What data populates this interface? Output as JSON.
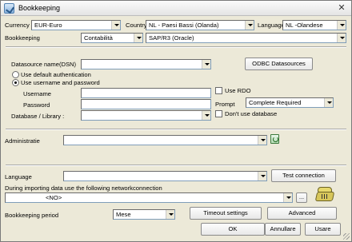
{
  "window": {
    "title": "Bookkeeping",
    "close_glyph": "✕"
  },
  "top": {
    "currency_label": "Currency",
    "currency_value": "EUR-Euro",
    "country_label": "Country",
    "country_value": "NL - Paesi Bassi (Olanda)",
    "language_label": "Language",
    "language_value": "NL -Olandese",
    "bookkeeping_label": "Bookkeeping",
    "bookkeeping_type": "Contabilità",
    "bookkeeping_system": "SAP/R3 (Oracle)"
  },
  "connection": {
    "dsn_label": "Datasource name(DSN)",
    "dsn_value": "",
    "odbc_button": "ODBC Datasources",
    "auth_default": "Use default authentication",
    "auth_userpass": "Use username and password",
    "username_label": "Username",
    "username_value": "",
    "password_label": "Password",
    "password_value": "",
    "use_rdo": "Use RDO",
    "prompt_label": "Prompt",
    "prompt_value": "Complete Required",
    "database_label": "Database / Library :",
    "database_value": "",
    "dont_use_db": "Don't use database"
  },
  "administratie": {
    "label": "Administratie",
    "value": ""
  },
  "language_section": {
    "label": "Language",
    "value": "",
    "test_button": "Test connection"
  },
  "network": {
    "label": "During importing data use the following networkconnection",
    "value": "<NO>",
    "browse_button": "..."
  },
  "period": {
    "label": "Bookkeeping period",
    "value": "Mese",
    "timeout_button": "Timeout settings",
    "advanced_button": "Advanced"
  },
  "footer": {
    "ok": "OK",
    "cancel": "Annullare",
    "use": "Usare"
  },
  "icons": {
    "app": "app-icon",
    "refresh": "refresh-icon",
    "network": "phone-icon"
  }
}
